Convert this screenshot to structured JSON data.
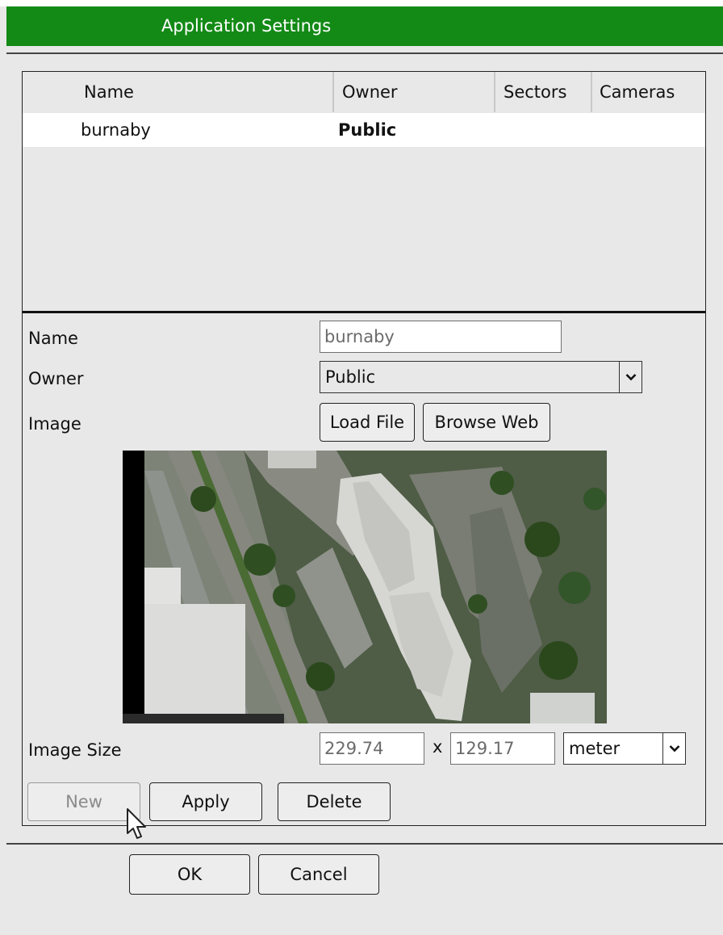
{
  "window": {
    "title": "Application Settings"
  },
  "grid": {
    "columns": [
      "Name",
      "Owner",
      "Sectors",
      "Cameras"
    ],
    "rows": [
      {
        "name": "burnaby",
        "owner": "Public",
        "sectors": "",
        "cameras": ""
      }
    ]
  },
  "form": {
    "name_label": "Name",
    "name_value": "burnaby",
    "owner_label": "Owner",
    "owner_value": "Public",
    "image_label": "Image",
    "load_file_label": "Load File",
    "browse_web_label": "Browse Web",
    "image_size_label": "Image Size",
    "width_value": "229.74",
    "times": "x",
    "height_value": "129.17",
    "unit_value": "meter"
  },
  "actions": {
    "new_label": "New",
    "apply_label": "Apply",
    "delete_label": "Delete"
  },
  "footer": {
    "ok_label": "OK",
    "cancel_label": "Cancel"
  }
}
